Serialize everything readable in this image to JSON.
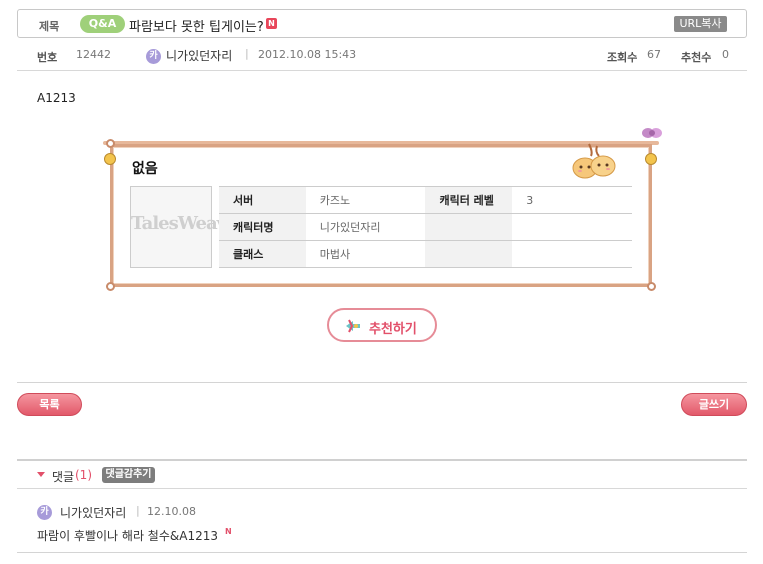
{
  "post": {
    "title_label": "제목",
    "category_badge": "Q&A",
    "title": "파람보다 못한 팁게이는?",
    "new_badge": "N",
    "url_copy": "URL복사",
    "number_label": "번호",
    "number": "12442",
    "author_icon": "카",
    "author": "니가있던자리",
    "date": "2012.10.08 15:43",
    "views_label": "조회수",
    "views": "67",
    "likes_label": "추천수",
    "likes": "0",
    "body": "A1213"
  },
  "character_card": {
    "title": "없음",
    "portrait_logo": "TalesWeaver",
    "rows": [
      {
        "k1": "서버",
        "v1": "카즈노",
        "k2": "캐릭터 레벨",
        "v2": "3"
      },
      {
        "k1": "캐릭터명",
        "v1": "니가있던자리",
        "k2": "",
        "v2": ""
      },
      {
        "k1": "클래스",
        "v1": "마법사",
        "k2": "",
        "v2": ""
      }
    ]
  },
  "recommend": {
    "label": "추천하기",
    "icon": "recommend-arrow-icon"
  },
  "buttons": {
    "list": "목록",
    "write": "글쓰기"
  },
  "comments": {
    "label": "댓글",
    "count": "(1)",
    "hide_button": "댓글감추기",
    "items": [
      {
        "author_icon": "카",
        "author": "니가있던자리",
        "date": "12.10.08",
        "text": "파람이 후빨이나 해라 철수&A1213",
        "new_badge": "N"
      }
    ]
  },
  "colors": {
    "accent": "#e2506a",
    "qa_badge": "#9fd07a",
    "frame": "#d9a383"
  }
}
